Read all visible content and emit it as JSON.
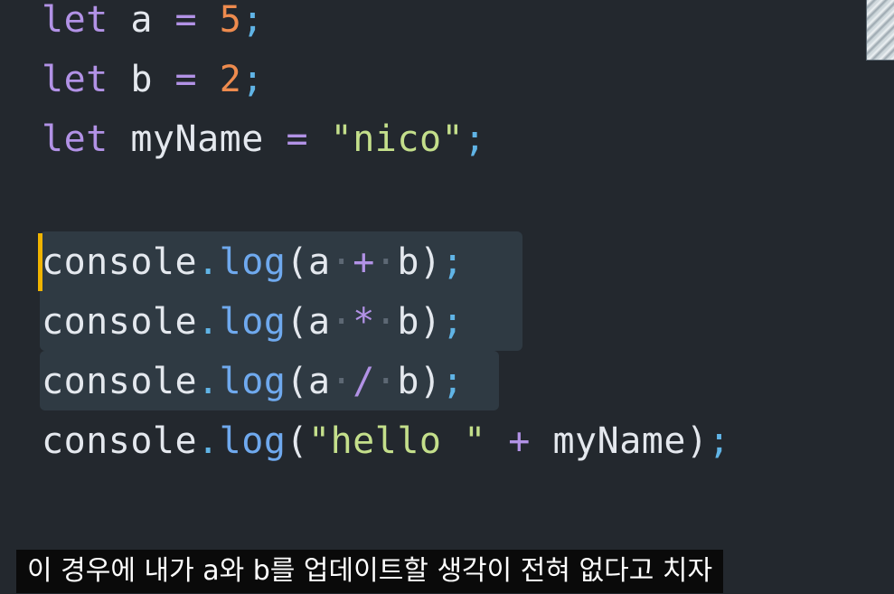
{
  "editor": {
    "lines": [
      {
        "tokens": [
          {
            "t": "let",
            "c": "kw"
          },
          {
            "t": " ",
            "c": "id"
          },
          {
            "t": "a",
            "c": "id"
          },
          {
            "t": " ",
            "c": "id"
          },
          {
            "t": "=",
            "c": "op"
          },
          {
            "t": " ",
            "c": "id"
          },
          {
            "t": "5",
            "c": "num"
          },
          {
            "t": ";",
            "c": "punc"
          }
        ]
      },
      {
        "tokens": [
          {
            "t": "let",
            "c": "kw"
          },
          {
            "t": " ",
            "c": "id"
          },
          {
            "t": "b",
            "c": "id"
          },
          {
            "t": " ",
            "c": "id"
          },
          {
            "t": "=",
            "c": "op"
          },
          {
            "t": " ",
            "c": "id"
          },
          {
            "t": "2",
            "c": "num"
          },
          {
            "t": ";",
            "c": "punc"
          }
        ]
      },
      {
        "tokens": [
          {
            "t": "let",
            "c": "kw"
          },
          {
            "t": " ",
            "c": "id"
          },
          {
            "t": "myName",
            "c": "id"
          },
          {
            "t": " ",
            "c": "id"
          },
          {
            "t": "=",
            "c": "op"
          },
          {
            "t": " ",
            "c": "id"
          },
          {
            "t": "\"nico\"",
            "c": "str"
          },
          {
            "t": ";",
            "c": "punc"
          }
        ]
      },
      {
        "tokens": []
      },
      {
        "tokens": [
          {
            "t": "console",
            "c": "id"
          },
          {
            "t": ".",
            "c": "dot"
          },
          {
            "t": "log",
            "c": "fn"
          },
          {
            "t": "(",
            "c": "id"
          },
          {
            "t": "a",
            "c": "id"
          },
          {
            "t": "·",
            "c": "ws"
          },
          {
            "t": "+",
            "c": "op"
          },
          {
            "t": "·",
            "c": "ws"
          },
          {
            "t": "b",
            "c": "id"
          },
          {
            "t": ")",
            "c": "id"
          },
          {
            "t": ";",
            "c": "punc"
          }
        ]
      },
      {
        "tokens": [
          {
            "t": "console",
            "c": "id"
          },
          {
            "t": ".",
            "c": "dot"
          },
          {
            "t": "log",
            "c": "fn"
          },
          {
            "t": "(",
            "c": "id"
          },
          {
            "t": "a",
            "c": "id"
          },
          {
            "t": "·",
            "c": "ws"
          },
          {
            "t": "*",
            "c": "op"
          },
          {
            "t": "·",
            "c": "ws"
          },
          {
            "t": "b",
            "c": "id"
          },
          {
            "t": ")",
            "c": "id"
          },
          {
            "t": ";",
            "c": "punc"
          }
        ]
      },
      {
        "tokens": [
          {
            "t": "console",
            "c": "id"
          },
          {
            "t": ".",
            "c": "dot"
          },
          {
            "t": "log",
            "c": "fn"
          },
          {
            "t": "(",
            "c": "id"
          },
          {
            "t": "a",
            "c": "id"
          },
          {
            "t": "·",
            "c": "ws"
          },
          {
            "t": "/",
            "c": "op"
          },
          {
            "t": "·",
            "c": "ws"
          },
          {
            "t": "b",
            "c": "id"
          },
          {
            "t": ")",
            "c": "id"
          },
          {
            "t": ";",
            "c": "punc"
          }
        ]
      },
      {
        "tokens": [
          {
            "t": "console",
            "c": "id"
          },
          {
            "t": ".",
            "c": "dot"
          },
          {
            "t": "log",
            "c": "fn"
          },
          {
            "t": "(",
            "c": "id"
          },
          {
            "t": "\"hello \"",
            "c": "str"
          },
          {
            "t": " ",
            "c": "id"
          },
          {
            "t": "+",
            "c": "op"
          },
          {
            "t": " ",
            "c": "id"
          },
          {
            "t": "myName",
            "c": "id"
          },
          {
            "t": ")",
            "c": "id"
          },
          {
            "t": ";",
            "c": "punc"
          }
        ]
      }
    ],
    "selected_lines": [
      5,
      6,
      7
    ],
    "cursor_line": 5
  },
  "subtitle": {
    "text": "이 경우에 내가 a와 b를 업데이트할 생각이 전혀 없다고 치자"
  },
  "colors": {
    "background": "#23282e",
    "keyword": "#b292e6",
    "number": "#ee8b4e",
    "string": "#c4df8b",
    "function": "#6fa9ee",
    "punctuation": "#60b4e6",
    "cursor": "#f0b400",
    "selection": "#2f3a43"
  }
}
